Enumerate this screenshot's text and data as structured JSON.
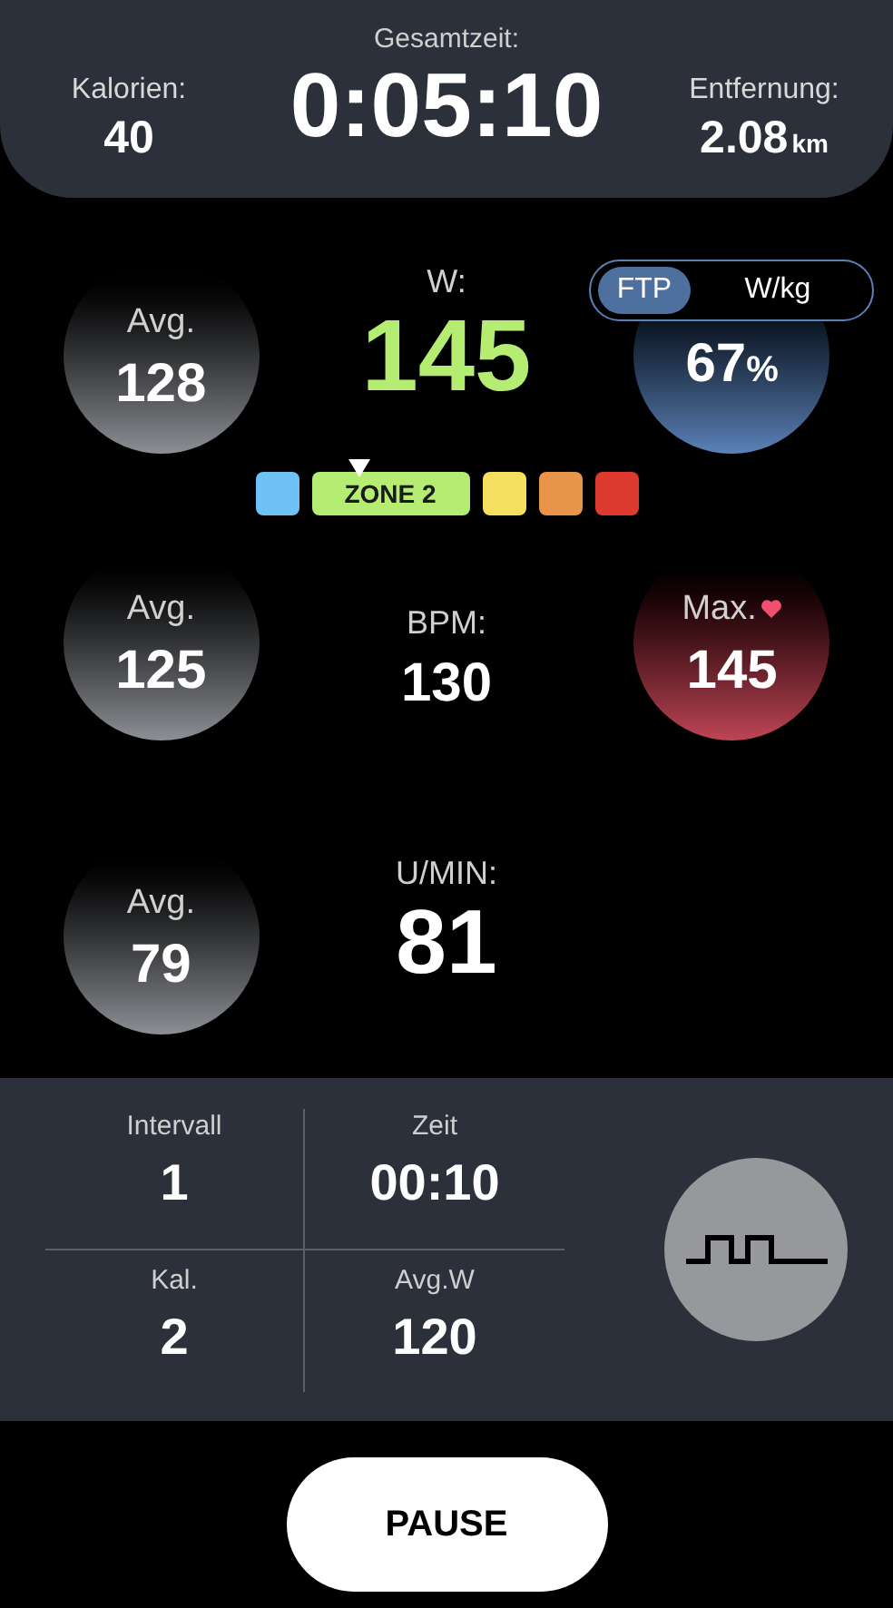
{
  "header": {
    "total_label": "Gesamtzeit:",
    "total_value": "0:05:10",
    "calories": {
      "label": "Kalorien:",
      "value": "40"
    },
    "distance": {
      "label": "Entfernung:",
      "value": "2.08",
      "unit": "km"
    }
  },
  "power": {
    "label": "W:",
    "value": "145",
    "avg": {
      "label": "Avg.",
      "value": "128"
    },
    "modes": [
      {
        "label": "FTP",
        "selected": true
      },
      {
        "label": "W/kg",
        "selected": false
      }
    ],
    "percent": "67",
    "percent_unit": "%"
  },
  "zone_label": "ZONE 2",
  "zones": [
    {
      "color": "#6ec1f5",
      "selected": false
    },
    {
      "color": "#b5ec72",
      "selected": true
    },
    {
      "color": "#f5df5e",
      "selected": false
    },
    {
      "color": "#e8954a",
      "selected": false
    },
    {
      "color": "#de3a30",
      "selected": false
    }
  ],
  "heart_rate": {
    "label": "BPM:",
    "value": "130",
    "avg": {
      "label": "Avg.",
      "value": "125"
    },
    "max": {
      "label": "Max.",
      "value": "145"
    }
  },
  "cadence": {
    "label": "U/MIN:",
    "value": "81",
    "avg": {
      "label": "Avg.",
      "value": "79"
    }
  },
  "interval_stats": [
    {
      "label": "Intervall",
      "value": "1"
    },
    {
      "label": "Zeit",
      "value": "00:10"
    },
    {
      "label": "Kal.",
      "value": "2"
    },
    {
      "label": "Avg.W",
      "value": "120"
    }
  ],
  "pause_button": "PAUSE"
}
